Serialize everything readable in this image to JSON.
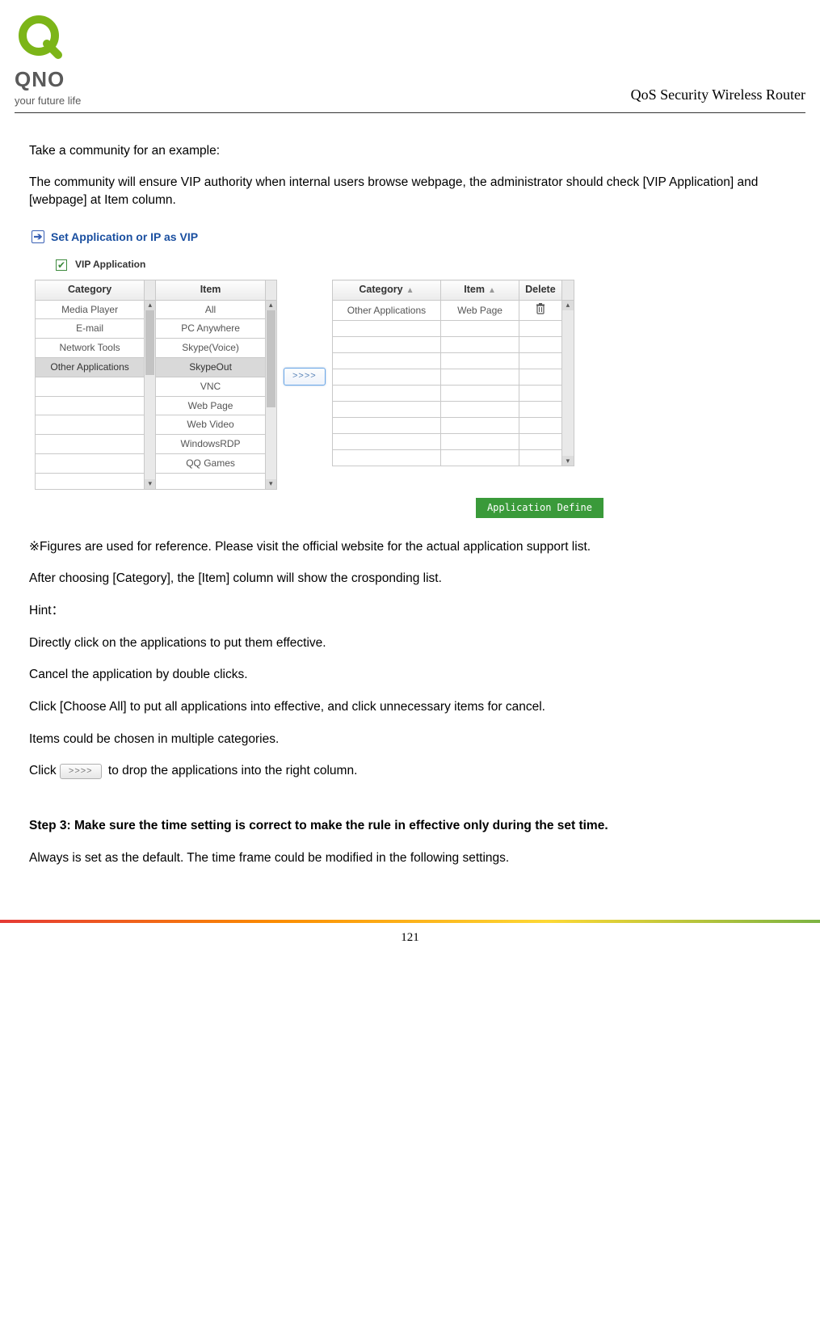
{
  "logo": {
    "brand": "QNO",
    "tagline": "your future life"
  },
  "product_title": "QoS Security Wireless Router",
  "paras": {
    "p1": "Take a community for an example:",
    "p2": "The community will ensure VIP authority when internal users browse webpage, the administrator should check [VIP Application] and [webpage] at Item column.",
    "note": "※Figures are used for reference. Please visit the official website for the actual application support list.",
    "p3": "After choosing [Category], the [Item] column will show the crosponding list.",
    "hint_label": "Hint：",
    "h1": "Directly click on the applications to put them effective.",
    "h2": "Cancel the application by double clicks.",
    "h3": "Click [Choose All] to put all applications into effective, and click unnecessary items for cancel.",
    "h4": "Items could be chosen in multiple categories.",
    "click_prefix": "Click",
    "click_suffix": "  to drop the applications into the right column.",
    "step3": "Step 3: Make sure the time setting is correct to make the rule in effective only during the set time.",
    "p4": "Always is set as the default.   The time frame could be modified in the following settings."
  },
  "ui": {
    "panel_title": "Set Application or IP as VIP",
    "vip_label": "VIP Application",
    "left": {
      "headers": {
        "category": "Category",
        "item": "Item"
      },
      "categories": [
        "Media Player",
        "E-mail",
        "Network Tools",
        "Other Applications",
        "",
        "",
        "",
        "",
        "",
        ""
      ],
      "selected_category_index": 3,
      "items": [
        "All",
        "PC Anywhere",
        "Skype(Voice)",
        "SkypeOut",
        "VNC",
        "Web Page",
        "Web Video",
        "WindowsRDP",
        "QQ Games",
        ""
      ]
    },
    "move_button": ">>>>",
    "right": {
      "headers": {
        "category": "Category",
        "item": "Item",
        "delete": "Delete"
      },
      "rows": [
        {
          "category": "Other Applications",
          "item": "Web Page",
          "has_delete": true
        },
        {
          "category": "",
          "item": "",
          "has_delete": false
        },
        {
          "category": "",
          "item": "",
          "has_delete": false
        },
        {
          "category": "",
          "item": "",
          "has_delete": false
        },
        {
          "category": "",
          "item": "",
          "has_delete": false
        },
        {
          "category": "",
          "item": "",
          "has_delete": false
        },
        {
          "category": "",
          "item": "",
          "has_delete": false
        },
        {
          "category": "",
          "item": "",
          "has_delete": false
        },
        {
          "category": "",
          "item": "",
          "has_delete": false
        },
        {
          "category": "",
          "item": "",
          "has_delete": false
        }
      ]
    },
    "app_define_label": "Application Define"
  },
  "inline_move_button": ">>>>",
  "page_number": "121"
}
